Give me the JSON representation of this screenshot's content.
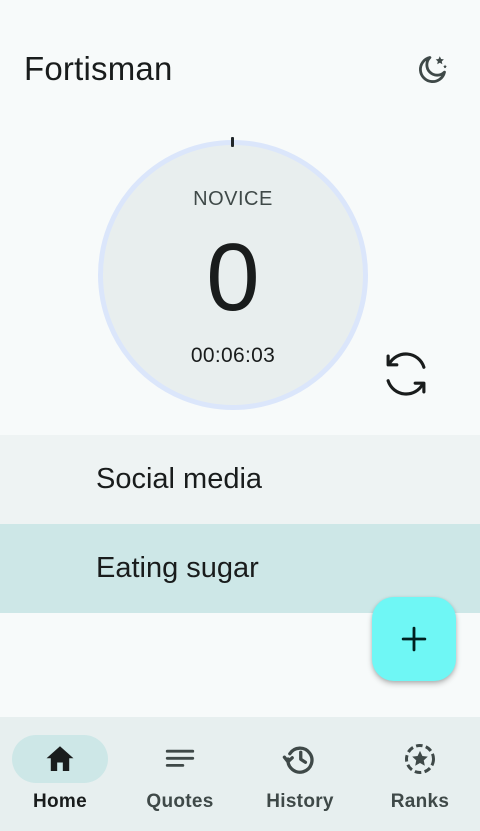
{
  "app": {
    "title": "Fortisman"
  },
  "header": {
    "theme_toggle_icon": "moon-stars-icon"
  },
  "timer": {
    "rank": "NOVICE",
    "streak_count": "0",
    "elapsed": "00:06:03",
    "reset_icon": "sync-icon"
  },
  "habits": [
    {
      "label": "Social media",
      "selected": false
    },
    {
      "label": "Eating sugar",
      "selected": true
    }
  ],
  "fab": {
    "icon": "plus-icon",
    "color": "#6ff7f5"
  },
  "bottom_nav": {
    "items": [
      {
        "label": "Home",
        "icon": "home-icon",
        "active": true
      },
      {
        "label": "Quotes",
        "icon": "quotes-icon",
        "active": false
      },
      {
        "label": "History",
        "icon": "history-icon",
        "active": false
      },
      {
        "label": "Ranks",
        "icon": "ranks-icon",
        "active": false
      }
    ]
  },
  "colors": {
    "background": "#f7fafa",
    "selected_item": "#cde7e7",
    "ring": "#dbe6fb",
    "nav_background": "#e7efef"
  }
}
